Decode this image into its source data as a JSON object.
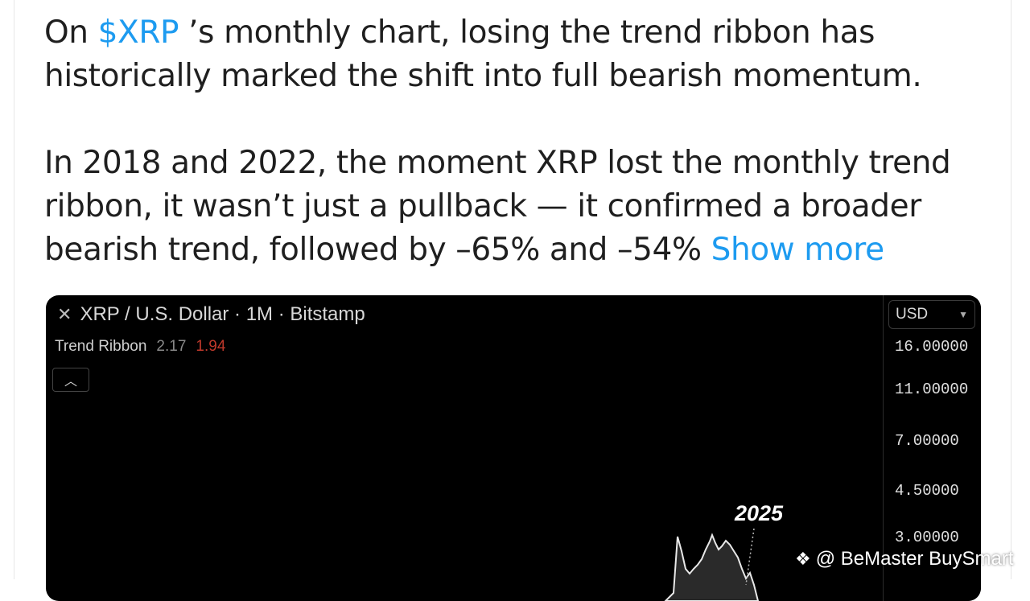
{
  "post": {
    "para1_before": "On ",
    "para1_tag": "$XRP",
    "para1_after": " ’s monthly chart, losing the trend ribbon has historically marked the shift into full bearish momentum.",
    "para2_text": "In 2018 and 2022, the moment XRP lost the monthly trend ribbon, it wasn’t just a pullback — it confirmed a broader bearish trend, followed by –65% and –54% ",
    "show_more": "Show more"
  },
  "chart": {
    "title": "XRP / U.S. Dollar · 1M · Bitstamp",
    "indicator_name": "Trend Ribbon",
    "indicator_value1": "2.17",
    "indicator_value2": "1.94",
    "collapse_icon": "chevron-up-icon",
    "currency": "USD",
    "price_ticks": [
      "16.00000",
      "11.00000",
      "7.00000",
      "4.50000",
      "3.00000"
    ],
    "annotation": "2025"
  },
  "watermark": {
    "text": "@ BeMaster BuySmart",
    "logo_icon": "binance-logo-icon"
  }
}
